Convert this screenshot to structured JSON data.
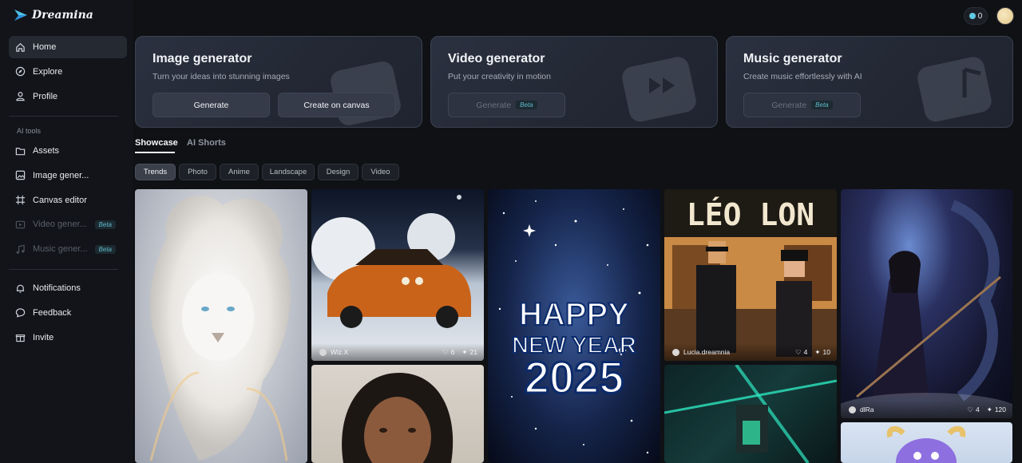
{
  "app": {
    "name": "Dreamina"
  },
  "topbar": {
    "credits": "0"
  },
  "sidebar": {
    "main_items": [
      {
        "label": "Home",
        "icon": "home-icon",
        "active": true
      },
      {
        "label": "Explore",
        "icon": "compass-icon"
      },
      {
        "label": "Profile",
        "icon": "user-icon"
      }
    ],
    "section_label": "AI tools",
    "tool_items": [
      {
        "label": "Assets",
        "icon": "folder-icon"
      },
      {
        "label": "Image gener...",
        "icon": "image-gen-icon"
      },
      {
        "label": "Canvas editor",
        "icon": "canvas-icon"
      },
      {
        "label": "Video gener...",
        "icon": "video-gen-icon",
        "badge": "Beta",
        "disabled": true
      },
      {
        "label": "Music gener...",
        "icon": "music-gen-icon",
        "badge": "Beta",
        "disabled": true
      }
    ],
    "bottom_items": [
      {
        "label": "Notifications",
        "icon": "bell-icon"
      },
      {
        "label": "Feedback",
        "icon": "chat-icon"
      },
      {
        "label": "Invite",
        "icon": "invite-icon"
      }
    ]
  },
  "cards": [
    {
      "title": "Image generator",
      "subtitle": "Turn your ideas into stunning images",
      "buttons": [
        {
          "label": "Generate"
        },
        {
          "label": "Create on canvas"
        }
      ]
    },
    {
      "title": "Video generator",
      "subtitle": "Put your creativity in motion",
      "buttons": [
        {
          "label": "Generate",
          "badge": "Beta",
          "disabled": true
        }
      ]
    },
    {
      "title": "Music generator",
      "subtitle": "Create music effortlessly with AI",
      "buttons": [
        {
          "label": "Generate",
          "badge": "Beta",
          "disabled": true
        }
      ]
    }
  ],
  "tabs": [
    {
      "label": "Showcase",
      "active": true
    },
    {
      "label": "AI Shorts"
    }
  ],
  "filters": [
    {
      "label": "Trends",
      "active": true
    },
    {
      "label": "Photo"
    },
    {
      "label": "Anime"
    },
    {
      "label": "Landscape"
    },
    {
      "label": "Design"
    },
    {
      "label": "Video"
    }
  ],
  "gallery": {
    "car": {
      "user": "Wiz.X",
      "likes": "6",
      "remixes": "21"
    },
    "leo": {
      "title_text": "LÉO LON",
      "user": "Lucia.dreamnia",
      "likes": "4",
      "remixes": "10"
    },
    "dragon": {
      "user": "dlRa",
      "likes": "4",
      "remixes": "120"
    },
    "newyear": {
      "line1": "HAPPY",
      "line2": "NEW YEAR",
      "line3": "2025"
    }
  },
  "colors": {
    "background": "#0f1115",
    "sidebar": "#121419",
    "accent": "#5fc8e0"
  }
}
